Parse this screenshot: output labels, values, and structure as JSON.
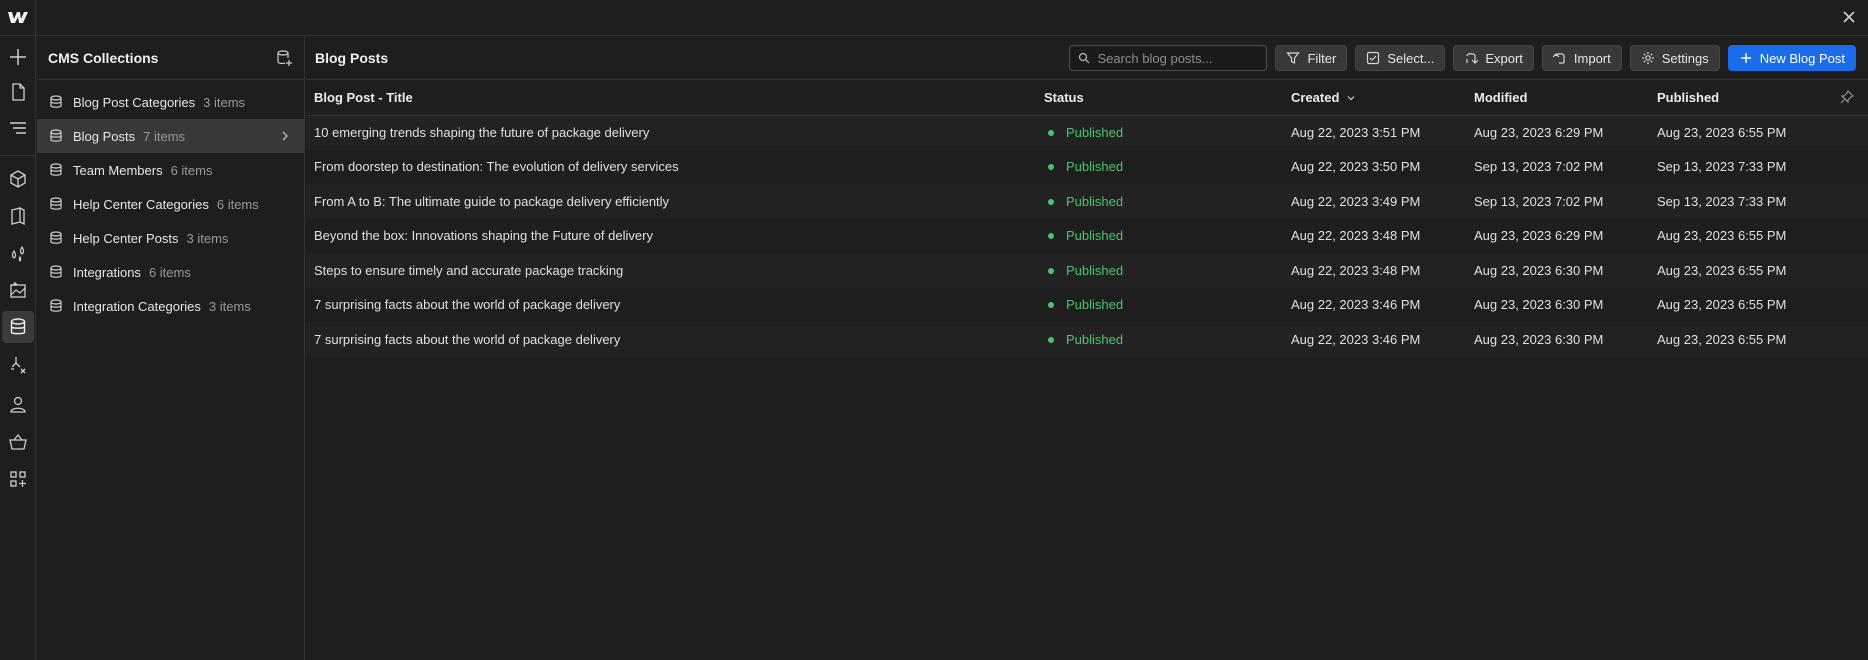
{
  "sidebar_title": "CMS Collections",
  "collections": [
    {
      "name": "Blog Post Categories",
      "count": "3 items"
    },
    {
      "name": "Blog Posts",
      "count": "7 items"
    },
    {
      "name": "Team Members",
      "count": "6 items"
    },
    {
      "name": "Help Center Categories",
      "count": "6 items"
    },
    {
      "name": "Help Center Posts",
      "count": "3 items"
    },
    {
      "name": "Integrations",
      "count": "6 items"
    },
    {
      "name": "Integration Categories",
      "count": "3 items"
    }
  ],
  "main": {
    "title": "Blog Posts",
    "search_placeholder": "Search blog posts...",
    "buttons": {
      "filter": "Filter",
      "select": "Select...",
      "export": "Export",
      "import": "Import",
      "settings": "Settings",
      "new": "New Blog Post"
    }
  },
  "table": {
    "columns": [
      "Blog Post - Title",
      "Status",
      "Created",
      "Modified",
      "Published"
    ],
    "rows": [
      [
        "10 emerging trends shaping the future of package delivery",
        "Published",
        "Aug 22, 2023 3:51 PM",
        "Aug 23, 2023 6:29 PM",
        "Aug 23, 2023 6:55 PM"
      ],
      [
        "From doorstep to destination: The evolution of delivery services",
        "Published",
        "Aug 22, 2023 3:50 PM",
        "Sep 13, 2023 7:02 PM",
        "Sep 13, 2023 7:33 PM"
      ],
      [
        "From A to B: The ultimate guide to package delivery efficiently",
        "Published",
        "Aug 22, 2023 3:49 PM",
        "Sep 13, 2023 7:02 PM",
        "Sep 13, 2023 7:33 PM"
      ],
      [
        "Beyond the box: Innovations shaping the Future of delivery",
        "Published",
        "Aug 22, 2023 3:48 PM",
        "Aug 23, 2023 6:29 PM",
        "Aug 23, 2023 6:55 PM"
      ],
      [
        "Steps to ensure timely and accurate package tracking",
        "Published",
        "Aug 22, 2023 3:48 PM",
        "Aug 23, 2023 6:30 PM",
        "Aug 23, 2023 6:55 PM"
      ],
      [
        "7 surprising facts about the world of package delivery",
        "Published",
        "Aug 22, 2023 3:46 PM",
        "Aug 23, 2023 6:30 PM",
        "Aug 23, 2023 6:55 PM"
      ],
      [
        "7 surprising facts about the world of package delivery",
        "Published",
        "Aug 22, 2023 3:46 PM",
        "Aug 23, 2023 6:30 PM",
        "Aug 23, 2023 6:55 PM"
      ]
    ]
  },
  "colors": {
    "accent": "#1a6ce8",
    "status_published": "#4cc46f",
    "background": "#1e1e1e"
  }
}
